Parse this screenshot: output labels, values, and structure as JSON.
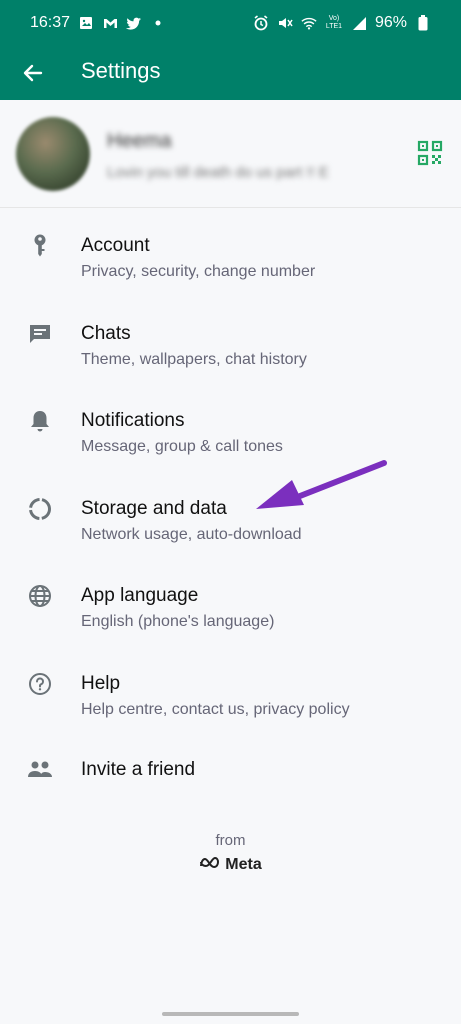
{
  "status_bar": {
    "time": "16:37",
    "left_icons": [
      "gallery-icon",
      "gmail-icon",
      "twitter-icon",
      "dot-icon"
    ],
    "right_icons": [
      "alarm-icon",
      "mute-icon",
      "wifi-icon",
      "volte-icon",
      "signal-icon"
    ],
    "volte_label": "Vo) LTE1",
    "battery": "96%"
  },
  "app_bar": {
    "back_icon": "arrow-back-icon",
    "title": "Settings",
    "bg_color": "#008069"
  },
  "profile": {
    "name": "Heema",
    "status": "Lovin you till death do us part !! E",
    "qr_icon": "qr-code-icon",
    "accent": "#25d366"
  },
  "menu": {
    "items": [
      {
        "icon": "key-icon",
        "title": "Account",
        "subtitle": "Privacy, security, change number"
      },
      {
        "icon": "chat-icon",
        "title": "Chats",
        "subtitle": "Theme, wallpapers, chat history"
      },
      {
        "icon": "bell-icon",
        "title": "Notifications",
        "subtitle": "Message, group & call tones"
      },
      {
        "icon": "storage-icon",
        "title": "Storage and data",
        "subtitle": "Network usage, auto-download"
      },
      {
        "icon": "globe-icon",
        "title": "App language",
        "subtitle": "English (phone's language)"
      },
      {
        "icon": "help-icon",
        "title": "Help",
        "subtitle": "Help centre, contact us, privacy policy"
      },
      {
        "icon": "people-icon",
        "title": "Invite a friend",
        "subtitle": ""
      }
    ]
  },
  "footer": {
    "from": "from",
    "brand": "Meta"
  },
  "annotation": {
    "arrow_color": "#7b2fbe",
    "points_to": "Storage and data"
  }
}
